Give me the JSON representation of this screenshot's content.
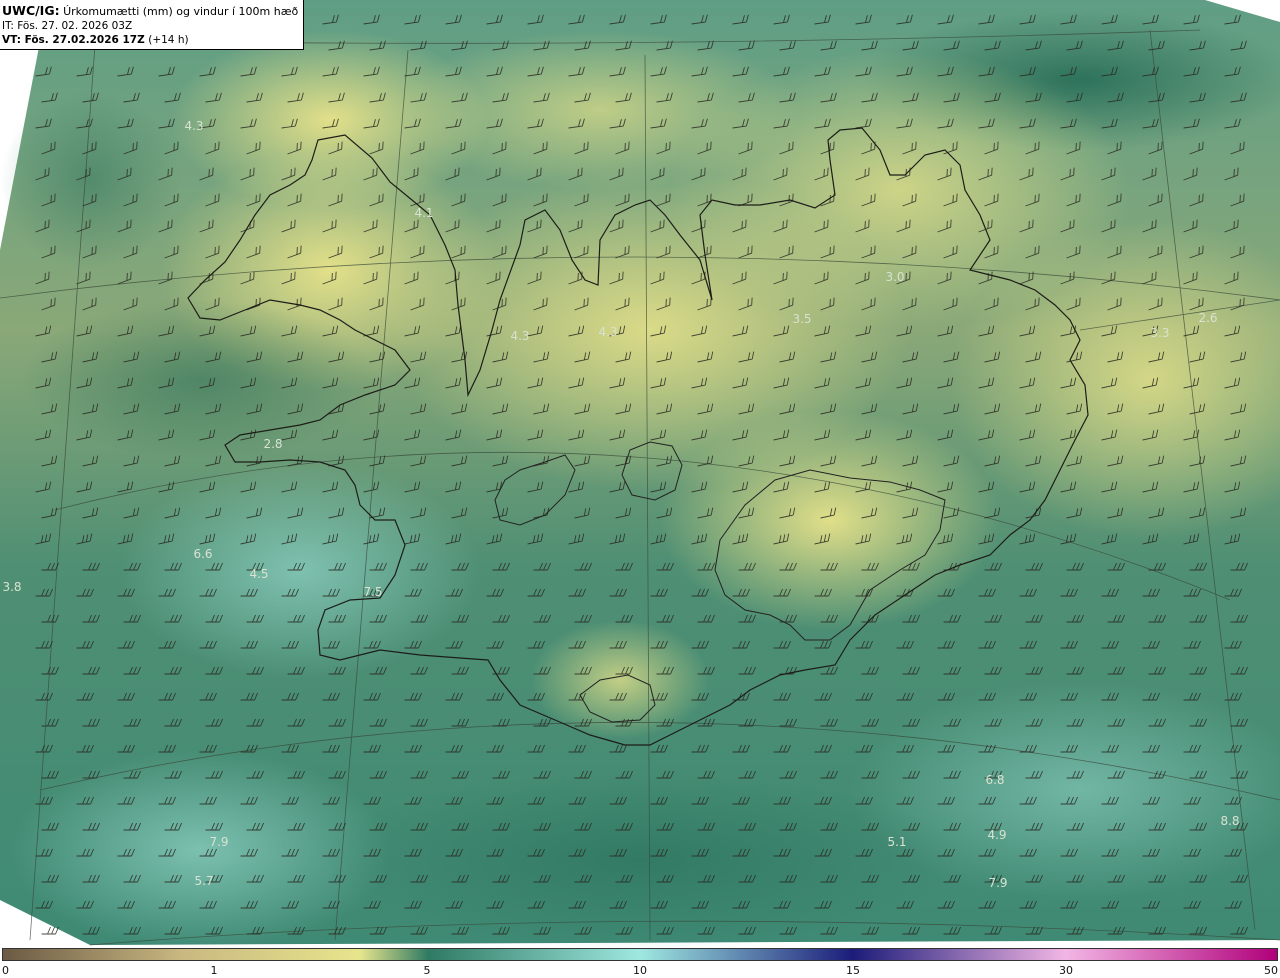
{
  "header": {
    "product": "UWC/IG:",
    "title": "Úrkomumætti (mm) og vindur í 100m hæð",
    "init_time": "IT: Fös. 27. 02. 2026 03Z",
    "valid_label": "VT: Fös. 27.02.2026 17Z",
    "lead": "(+14 h)"
  },
  "map": {
    "values": [
      {
        "id": "v1",
        "text": "4.3"
      },
      {
        "id": "v2",
        "text": "4.1"
      },
      {
        "id": "v3",
        "text": "4.3"
      },
      {
        "id": "v4",
        "text": "4.3"
      },
      {
        "id": "v5",
        "text": "3.5"
      },
      {
        "id": "v6",
        "text": "3.3"
      },
      {
        "id": "v7",
        "text": "2.6"
      },
      {
        "id": "v8",
        "text": "2.8"
      },
      {
        "id": "v9",
        "text": "6.6"
      },
      {
        "id": "v10",
        "text": "4.5"
      },
      {
        "id": "v11",
        "text": "7.5"
      },
      {
        "id": "v12",
        "text": "3.8"
      },
      {
        "id": "v13",
        "text": "7.9"
      },
      {
        "id": "v14",
        "text": "5.7"
      },
      {
        "id": "v15",
        "text": "5.1"
      },
      {
        "id": "v16",
        "text": "4.9"
      },
      {
        "id": "v17",
        "text": "7.9"
      },
      {
        "id": "v18",
        "text": "6.8"
      },
      {
        "id": "v19",
        "text": "8.8"
      },
      {
        "id": "v20",
        "text": "3.0"
      }
    ]
  },
  "colorbar": {
    "ticks": [
      "0",
      "1",
      "5",
      "10",
      "15",
      "30",
      "50"
    ],
    "colors": [
      "#6b5a44",
      "#c9b880",
      "#e7e58c",
      "#2f7a63",
      "#9ee8e0",
      "#1c1c7a",
      "#f2b6e4",
      "#b0007a"
    ]
  }
}
